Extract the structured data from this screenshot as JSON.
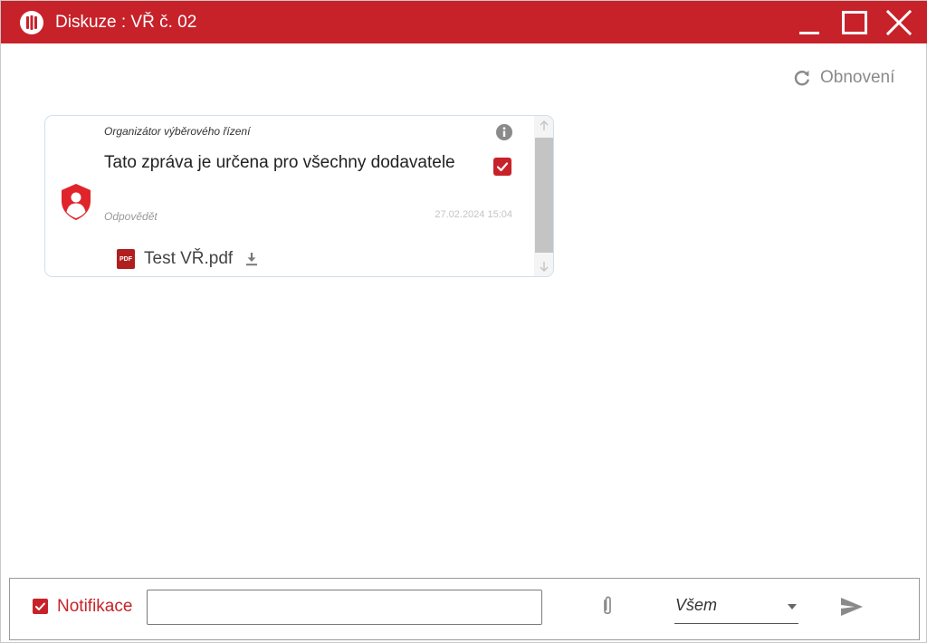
{
  "window": {
    "title": "Diskuze : VŘ č. 02",
    "accent_color": "#c7222a"
  },
  "toolbar": {
    "refresh_label": "Obnovení",
    "refresh_icon": "refresh-icon"
  },
  "message": {
    "sender": "Organizátor výběrového řízení",
    "text": "Tato zpráva je určena pro všechny dodavatele",
    "reply_label": "Odpovědět",
    "timestamp": "27.02.2024 15:04",
    "checked": true,
    "attachment": {
      "badge": "PDF",
      "name": "Test VŘ.pdf"
    }
  },
  "composer": {
    "notify_label": "Notifikace",
    "notify_checked": true,
    "input_value": "",
    "input_placeholder": "",
    "recipient": "Všem"
  }
}
